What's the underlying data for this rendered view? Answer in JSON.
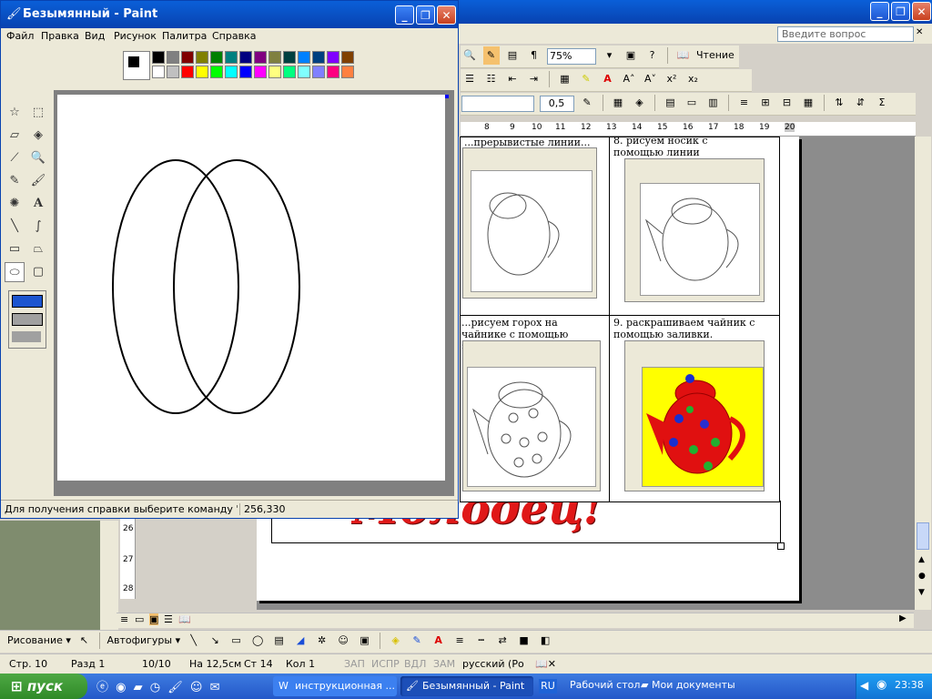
{
  "paint": {
    "title": "Безымянный - Paint",
    "menu": [
      "Файл",
      "Правка",
      "Вид",
      "Рисунок",
      "Палитра",
      "Справка"
    ],
    "status_help": "Для получения справки выберите команду \"Вызов",
    "status_coords": "256,330",
    "palette_top": [
      "#000000",
      "#808080",
      "#800000",
      "#808000",
      "#008000",
      "#008080",
      "#000080",
      "#800080",
      "#808040",
      "#004040",
      "#0080ff",
      "#004080",
      "#8000ff",
      "#804000"
    ],
    "palette_bottom": [
      "#ffffff",
      "#c0c0c0",
      "#ff0000",
      "#ffff00",
      "#00ff00",
      "#00ffff",
      "#0000ff",
      "#ff00ff",
      "#ffff80",
      "#00ff80",
      "#80ffff",
      "#8080ff",
      "#ff0080",
      "#ff8040"
    ],
    "text_tool": "A"
  },
  "word": {
    "question_placeholder": "Введите вопрос",
    "zoom": "75%",
    "reading_label": "Чтение",
    "line_width": "0,5",
    "ruler_ticks": [
      "8",
      "9",
      "10",
      "11",
      "12",
      "13",
      "14",
      "15",
      "16",
      "17",
      "18",
      "19",
      "20"
    ],
    "vruler_ticks": [
      "26",
      "27",
      "28"
    ],
    "cells": {
      "top_left_caption": "...прерывистые линии...",
      "top_right_caption": "8.   рисуем носик с помощью линии",
      "bottom_left_caption": "...рисуем горох на чайнике с помощью эллипса",
      "bottom_right_caption": "9.   раскрашиваем чайник с помощью заливки."
    },
    "big_text": "Молодец!",
    "drawing_toolbar": {
      "draw_label": "Рисование",
      "autoshapes_label": "Автофигуры"
    },
    "status": {
      "page": "Стр.  10",
      "section": "Разд  1",
      "pages": "10/10",
      "at": "На  12,5см",
      "line": "Ст  14",
      "col": "Кол  1",
      "rec": "ЗАП",
      "trk": "ИСПР",
      "ext": "ВДЛ",
      "ovr": "ЗАМ",
      "lang": "русский (Ро"
    }
  },
  "taskbar": {
    "start_label": "пуск",
    "tasks": [
      "инструкционная ...",
      "Безымянный - Paint"
    ],
    "lang": "RU",
    "desktop": "Рабочий стол",
    "documents": "Мои документы",
    "clock": "23:38"
  }
}
